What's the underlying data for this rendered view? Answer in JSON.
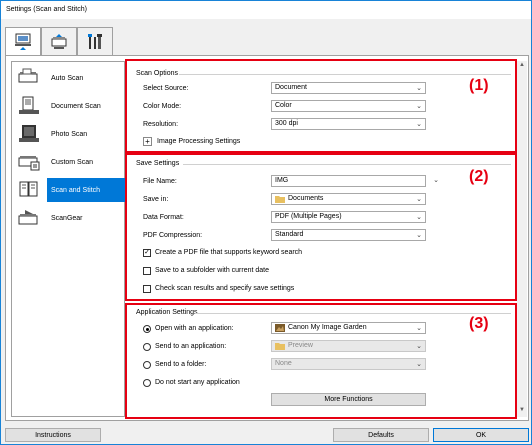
{
  "window": {
    "title": "Settings (Scan and Stitch)"
  },
  "tabs": [
    {
      "name": "scan-from-computer",
      "active": true
    },
    {
      "name": "scan-from-panel",
      "active": false
    },
    {
      "name": "general-settings",
      "active": false
    }
  ],
  "sidebar": {
    "items": [
      {
        "label": "Auto Scan",
        "icon": "auto-scan-icon"
      },
      {
        "label": "Document Scan",
        "icon": "document-scan-icon"
      },
      {
        "label": "Photo Scan",
        "icon": "photo-scan-icon"
      },
      {
        "label": "Custom Scan",
        "icon": "custom-scan-icon"
      },
      {
        "label": "Scan and Stitch",
        "icon": "scan-and-stitch-icon",
        "active": true
      },
      {
        "label": "ScanGear",
        "icon": "scangear-icon"
      }
    ]
  },
  "scan_options": {
    "heading": "Scan Options",
    "number": "(1)",
    "select_source_label": "Select Source:",
    "select_source_value": "Document",
    "color_mode_label": "Color Mode:",
    "color_mode_value": "Color",
    "resolution_label": "Resolution:",
    "resolution_value": "300 dpi",
    "image_processing_label": "Image Processing Settings",
    "expander_glyph": "+"
  },
  "save_settings": {
    "heading": "Save Settings",
    "number": "(2)",
    "file_name_label": "File Name:",
    "file_name_value": "IMG",
    "save_in_label": "Save in:",
    "save_in_value": "Documents",
    "data_format_label": "Data Format:",
    "data_format_value": "PDF (Multiple Pages)",
    "pdf_compression_label": "PDF Compression:",
    "pdf_compression_value": "Standard",
    "keyword_search_label": "Create a PDF file that supports keyword search",
    "keyword_search_checked": true,
    "subfolder_label": "Save to a subfolder with current date",
    "subfolder_checked": false,
    "check_results_label": "Check scan results and specify save settings",
    "check_results_checked": false
  },
  "application_settings": {
    "heading": "Application Settings",
    "number": "(3)",
    "open_with_label": "Open with an application:",
    "open_with_value": "Canon My Image Garden",
    "send_to_app_label": "Send to an application:",
    "send_to_app_value": "Preview",
    "send_to_folder_label": "Send to a folder:",
    "send_to_folder_value": "None",
    "do_not_start_label": "Do not start any application",
    "selected": "open_with",
    "more_functions_label": "More Functions"
  },
  "footer": {
    "instructions_label": "Instructions",
    "defaults_label": "Defaults",
    "ok_label": "OK"
  },
  "colors": {
    "highlight_red": "#e60012",
    "selection_blue": "#0078d7",
    "window_border": "#1883d7"
  },
  "glyphs": {
    "chevron": "⌄",
    "check": "✓",
    "scroll_up": "▲",
    "scroll_down": "▼"
  }
}
